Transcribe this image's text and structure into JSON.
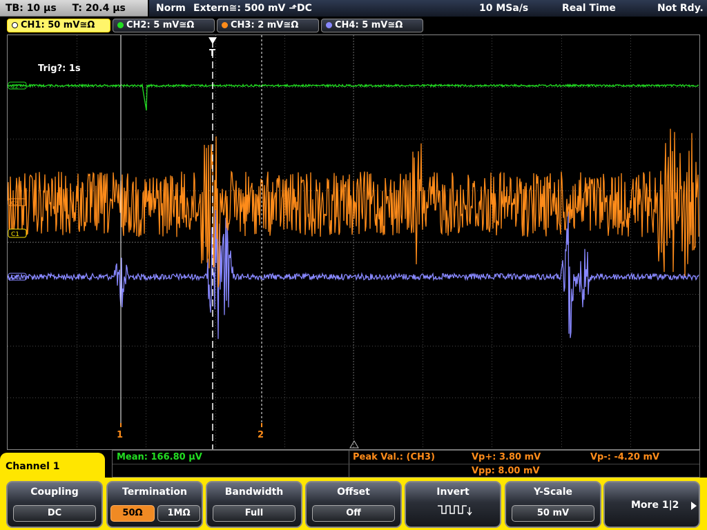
{
  "topbar": {
    "timebase": "TB: 10 µs",
    "trigger_time": "T: 20.4 µs",
    "trigger_mode": "Norm",
    "trigger_source": "Extern≅: 500 mV ⬏DC",
    "sample_rate": "10 MSa/s",
    "acq_mode": "Real Time",
    "status": "Not Rdy."
  },
  "channel_tabs": [
    {
      "label": "CH1: 50 mV≅Ω",
      "color": "#ffe600",
      "active": true
    },
    {
      "label": "CH2: 5 mV≅Ω",
      "color": "#22dd22",
      "active": false
    },
    {
      "label": "CH3: 2 mV≅Ω",
      "color": "#ff8c1a",
      "active": false
    },
    {
      "label": "CH4: 5 mV≅Ω",
      "color": "#8888ff",
      "active": false
    }
  ],
  "screen": {
    "trigger_timeout": "Trig?: 1s",
    "trigger_marker": "T",
    "cursor1_label": "1",
    "cursor2_label": "2",
    "ch2_marker": "C2",
    "ch3_marker": "C3",
    "ch1_marker": "C1",
    "ch4_marker": "C4"
  },
  "measurements": {
    "mean": "Mean: 166.80 µV",
    "peak_label": "Peak Val.: (CH3)",
    "vp_plus": "Vp+: 3.80 mV",
    "vp_minus": "Vp-: -4.20 mV",
    "vpp": "Vpp: 8.00 mV"
  },
  "menu": {
    "title": "Channel 1",
    "coupling": {
      "label": "Coupling",
      "value": "DC"
    },
    "termination": {
      "label": "Termination",
      "opt1": "50Ω",
      "opt2": "1MΩ",
      "selected": "50Ω"
    },
    "bandwidth": {
      "label": "Bandwidth",
      "value": "Full"
    },
    "offset": {
      "label": "Offset",
      "value": "Off"
    },
    "invert": {
      "label": "Invert",
      "icon": "invert-square-wave-icon"
    },
    "yscale": {
      "label": "Y-Scale",
      "value": "50 mV"
    },
    "more": {
      "label": "More 1|2",
      "icon": "arrow-right-icon"
    }
  },
  "colors": {
    "ch1": "#ffe600",
    "ch2": "#22dd22",
    "ch3": "#ff8c1a",
    "ch4": "#8888ff",
    "measure_ch2": "#22dd22",
    "measure_ch3": "#ff8c1a"
  }
}
